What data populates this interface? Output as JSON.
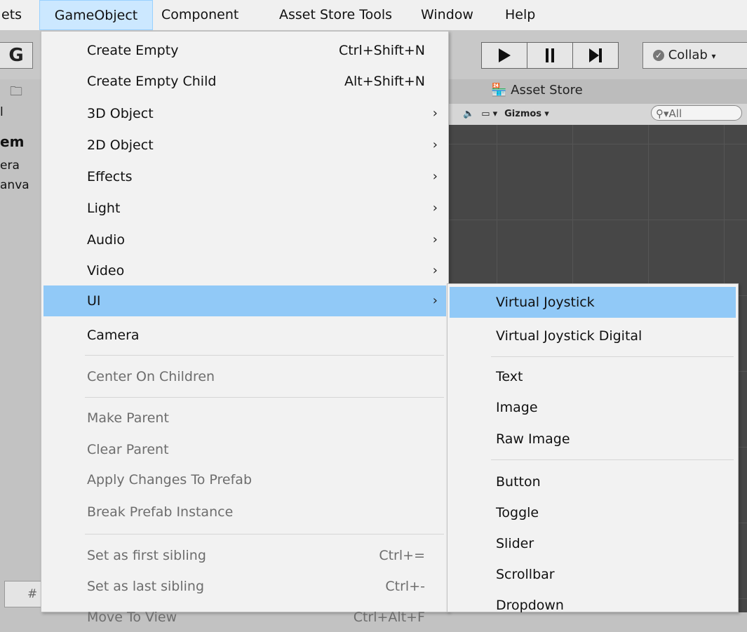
{
  "menubar": {
    "items": [
      "ets",
      "GameObject",
      "Component",
      "Asset Store Tools",
      "Window",
      "Help"
    ]
  },
  "toolbar": {
    "g_button": "G",
    "collab_label": "Collab",
    "asset_store_tab": "Asset Store",
    "gizmos_label": "Gizmos",
    "search_placeholder": "All"
  },
  "hierarchy": {
    "header": "em",
    "rows": [
      "era",
      "anva"
    ],
    "search_stub": "l"
  },
  "gameobject_menu": {
    "items": [
      {
        "label": "Create Empty",
        "shortcut": "Ctrl+Shift+N"
      },
      {
        "label": "Create Empty Child",
        "shortcut": "Alt+Shift+N"
      },
      {
        "label": "3D Object",
        "arrow": "›"
      },
      {
        "label": "2D Object",
        "arrow": "›"
      },
      {
        "label": "Effects",
        "arrow": "›"
      },
      {
        "label": "Light",
        "arrow": "›"
      },
      {
        "label": "Audio",
        "arrow": "›"
      },
      {
        "label": "Video",
        "arrow": "›"
      },
      {
        "label": "UI",
        "arrow": "›"
      },
      {
        "label": "Camera"
      },
      {
        "label": "Center On Children"
      },
      {
        "label": "Make Parent"
      },
      {
        "label": "Clear Parent"
      },
      {
        "label": "Apply Changes To Prefab"
      },
      {
        "label": "Break Prefab Instance"
      },
      {
        "label": "Set as first sibling",
        "shortcut": "Ctrl+="
      },
      {
        "label": "Set as last sibling",
        "shortcut": "Ctrl+-"
      },
      {
        "label": "Move To View",
        "shortcut": "Ctrl+Alt+F"
      }
    ]
  },
  "ui_submenu": {
    "items": [
      "Virtual Joystick",
      "Virtual Joystick Digital",
      "Text",
      "Image",
      "Raw Image",
      "Button",
      "Toggle",
      "Slider",
      "Scrollbar",
      "Dropdown"
    ]
  },
  "colors": {
    "highlight": "#91c9f7",
    "active_menu": "#cce8ff",
    "scene_bg": "#474747"
  }
}
